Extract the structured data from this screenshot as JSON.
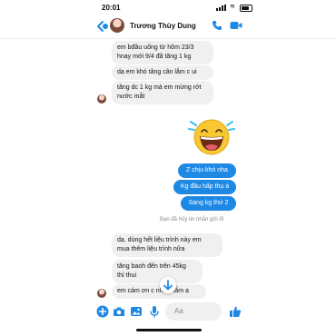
{
  "status_bar": {
    "time": "20:01"
  },
  "header": {
    "contact_name": "Trương Thùy Dung"
  },
  "messages": [
    {
      "text": "em bđầu uống từ hôm 23/3\nhnay mới 9/4 đã tăng 1 kg",
      "side": "in"
    },
    {
      "text": "dạ em khó tăng cân lắm c ui",
      "side": "in"
    },
    {
      "text": "tăng dc 1 kg mà em mừng rớt\nnước mắt",
      "side": "in"
    },
    {
      "text": "Z chịu khó nha",
      "side": "out"
    },
    {
      "text": "Kg đầu hấp thụ á",
      "side": "out"
    },
    {
      "text": "Sang kg thứ 2",
      "side": "out"
    },
    {
      "text": "dạ. dùng hết liệu trình này em\nmua thêm liệu trình nữa",
      "side": "in"
    },
    {
      "text": "tăng baoh đến trên 45kg\nthì thui",
      "side": "in"
    },
    {
      "text": "em cám ơn c nhiều lắm ạ",
      "side": "in"
    }
  ],
  "unsent_notice": "Bạn đã hủy tin nhắn gửi đi",
  "composer": {
    "placeholder": "Aa"
  },
  "icons": {
    "back": "chevron-left-icon",
    "call": "phone-icon",
    "video": "video-camera-icon",
    "scroll_down": "arrow-down-icon",
    "emoji_sticker": "laughing-face-icon",
    "composer": [
      "plus-icon",
      "camera-icon",
      "image-icon",
      "microphone-icon",
      "emoji-icon",
      "like-icon"
    ]
  },
  "colors": {
    "accent": "#1e88e5",
    "incoming_bubble": "#f0f0f0",
    "outgoing_text": "#ffffff"
  }
}
